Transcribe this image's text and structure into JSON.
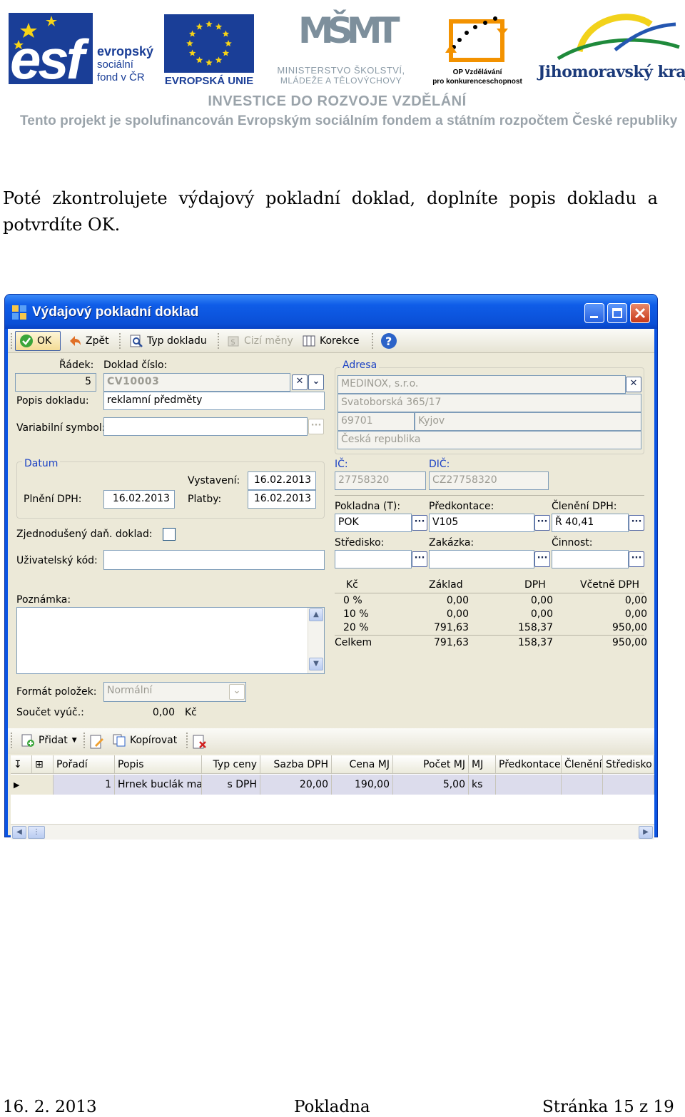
{
  "header": {
    "esf_logo": {
      "big": "esf",
      "line1": "evropský",
      "line2": "sociální",
      "line3": "fond v ČR"
    },
    "eu_label": "EVROPSKÁ UNIE",
    "msmt": {
      "logo": "MŠMT",
      "line1": "MINISTERSTVO ŠKOLSTVÍ,",
      "line2": "MLÁDEŽE A TĚLOVÝCHOVY"
    },
    "op": {
      "line1": "OP Vzdělávání",
      "line2": "pro konkurenceschopnost"
    },
    "jmk": "Jihomoravský kraj",
    "investice": "INVESTICE DO ROZVOJE VZDĚLÁNÍ",
    "project_line": "Tento projekt je spolufinancován Evropským sociálním fondem a státním rozpočtem České republiky"
  },
  "intro": "Poté zkontrolujete výdajový pokladní doklad, doplníte popis dokladu a potvrdíte OK.",
  "window": {
    "title": "Výdajový pokladní doklad",
    "toolbar": {
      "ok": "OK",
      "back": "Zpět",
      "doc_type": "Typ dokladu",
      "foreign_currency": "Cizí měny",
      "correction": "Korekce"
    },
    "form": {
      "row_label": "Řádek:",
      "row_value": "5",
      "doc_number_label": "Doklad číslo:",
      "doc_number_value": "CV10003",
      "desc_label": "Popis dokladu:",
      "desc_value": "reklamní předměty",
      "varsym_label": "Variabilní symbol:",
      "varsym_value": "",
      "date_group": "Datum",
      "issued_label": "Vystavení:",
      "issued_value": "16.02.2013",
      "vat_date_label": "Plnění DPH:",
      "vat_date_value": "16.02.2013",
      "payment_label": "Platby:",
      "payment_value": "16.02.2013",
      "simplified_label": "Zjednodušený daň. doklad:",
      "user_code_label": "Uživatelský kód:",
      "user_code_value": "",
      "note_label": "Poznámka:",
      "note_value": "",
      "item_format_label": "Formát položek:",
      "item_format_value": "Normální",
      "sum_label": "Součet vyúč.:",
      "sum_value": "0,00",
      "sum_currency": "Kč"
    },
    "address": {
      "group": "Adresa",
      "name": "MEDINOX, s.r.o.",
      "street": "Svatoborská 365/17",
      "zip": "69701",
      "city": "Kyjov",
      "country": "Česká republika",
      "ic_label": "IČ:",
      "ic_value": "27758320",
      "dic_label": "DIČ:",
      "dic_value": "CZ27758320"
    },
    "accounting": {
      "register_label": "Pokladna (T):",
      "register_value": "POK",
      "predkontace_label": "Předkontace:",
      "predkontace_value": "V105",
      "vat_class_label": "Členění DPH:",
      "vat_class_value": "Ř 40,41",
      "centre_label": "Středisko:",
      "centre_value": "",
      "order_label": "Zakázka:",
      "order_value": "",
      "activity_label": "Činnost:",
      "activity_value": ""
    },
    "vat_table": {
      "headers": [
        "Kč",
        "Základ",
        "DPH",
        "Včetně DPH"
      ],
      "rows": [
        [
          "0 %",
          "0,00",
          "0,00",
          "0,00"
        ],
        [
          "10 %",
          "0,00",
          "0,00",
          "0,00"
        ],
        [
          "20 %",
          "791,63",
          "158,37",
          "950,00"
        ],
        [
          "Celkem",
          "791,63",
          "158,37",
          "950,00"
        ]
      ]
    },
    "items_toolbar": {
      "add": "Přidat",
      "copy": "Kopírovat"
    },
    "items_grid": {
      "headers": [
        "Pořadí",
        "Popis",
        "Typ ceny",
        "Sazba DPH",
        "Cena MJ",
        "Počet MJ",
        "MJ",
        "Předkontace",
        "Členění",
        "Středisko"
      ],
      "rows": [
        [
          "1",
          "Hrnek buclák ma",
          "s DPH",
          "20,00",
          "190,00",
          "5,00",
          "ks",
          "",
          "",
          ""
        ]
      ]
    }
  },
  "footer": {
    "date": "16. 2. 2013",
    "title": "Pokladna",
    "page": "Stránka 15 z 19"
  }
}
